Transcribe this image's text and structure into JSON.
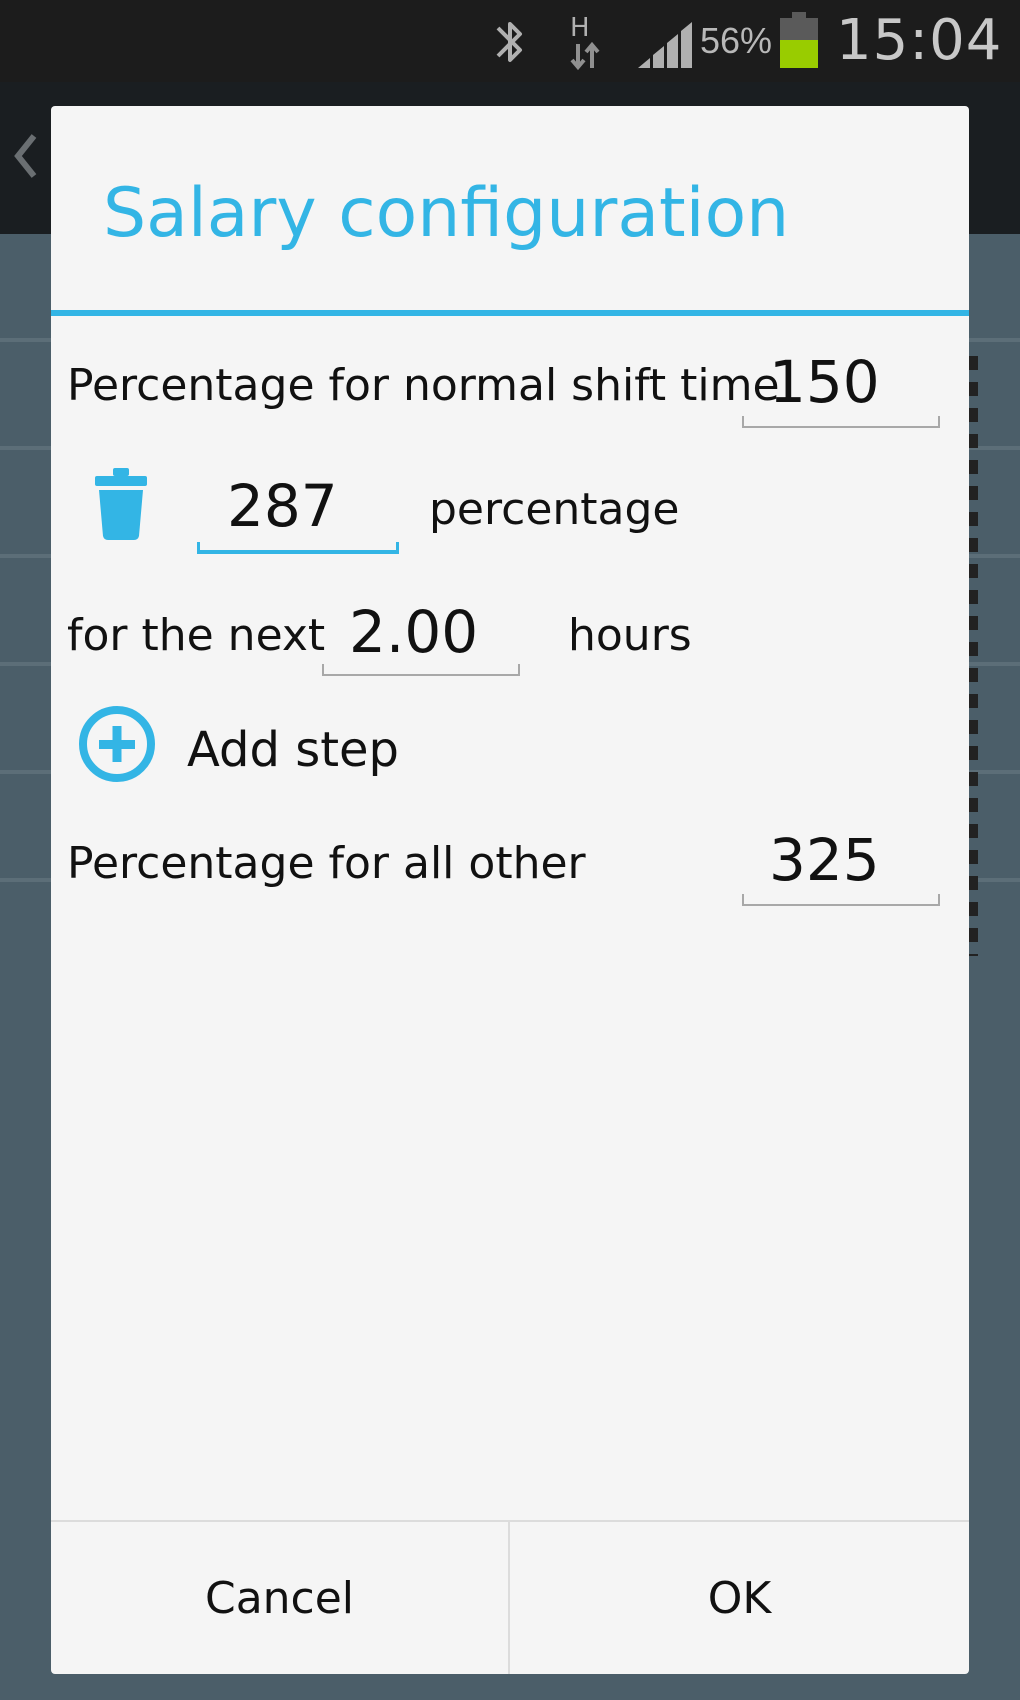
{
  "status_bar": {
    "battery_percent": "56%",
    "time": "15:04",
    "network_type": "H",
    "battery_level_fraction": 0.56,
    "battery_color": "#99cc00",
    "icons": [
      "bluetooth-icon",
      "hspa-data-icon",
      "signal-icon",
      "battery-icon"
    ]
  },
  "dialog": {
    "title": "Salary configuration",
    "accent_color": "#33b5e5",
    "normal_shift": {
      "label": "Percentage for normal shift time",
      "value": "150"
    },
    "step": {
      "percentage_value": "287",
      "percentage_label": "percentage",
      "for_next_label": "for the next",
      "hours_value": "2.00",
      "hours_label": "hours"
    },
    "add_step_label": "Add step",
    "all_other": {
      "label": "Percentage for all other",
      "value": "325"
    },
    "buttons": {
      "cancel": "Cancel",
      "ok": "OK"
    }
  }
}
